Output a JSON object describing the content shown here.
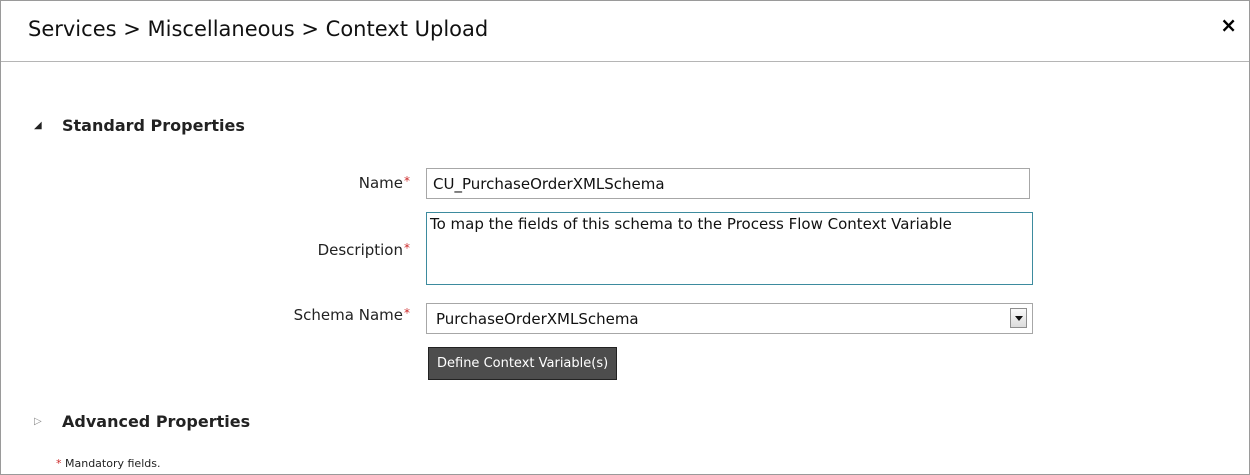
{
  "header": {
    "breadcrumb": "Services > Miscellaneous > Context Upload",
    "close_label": "×"
  },
  "standard_properties": {
    "label": "Standard Properties",
    "expanded": true,
    "name_label": "Name",
    "name_value": "CU_PurchaseOrderXMLSchema",
    "description_label": "Description",
    "description_value": "To map the fields of this schema to the Process Flow Context Variable",
    "schema_label": "Schema Name",
    "schema_value": "PurchaseOrderXMLSchema",
    "define_button": "Define Context Variable(s)",
    "required_marker": "*"
  },
  "advanced_properties": {
    "label": "Advanced Properties",
    "expanded": false
  },
  "footer": {
    "mandatory_star": "*",
    "mandatory_text": " Mandatory fields."
  },
  "colors": {
    "required": "#cc2a2a",
    "button_bg": "#4d4d4d",
    "focus_border": "#3d8b9e"
  },
  "icons": {
    "close": "close-icon",
    "expanded": "triangle-down-icon",
    "collapsed": "triangle-right-icon",
    "dropdown": "chevron-down-icon"
  }
}
